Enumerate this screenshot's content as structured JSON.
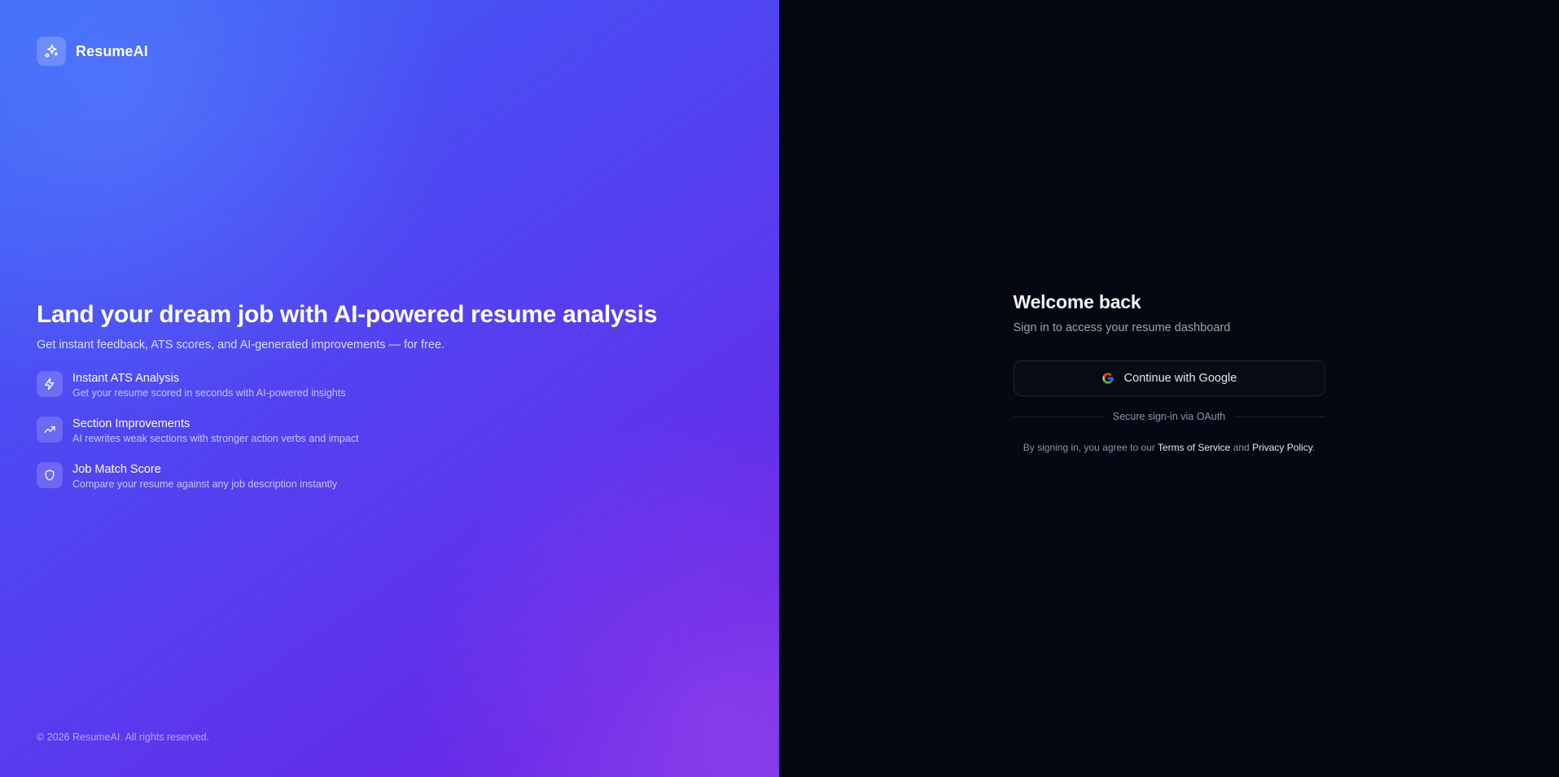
{
  "brand": {
    "name": "ResumeAI",
    "icon": "sparkles-icon"
  },
  "hero": {
    "headline": "Land your dream job with AI-powered resume analysis",
    "subtitle": "Get instant feedback, ATS scores, and AI-generated improvements — for free."
  },
  "features": [
    {
      "icon": "zap-icon",
      "title": "Instant ATS Analysis",
      "desc": "Get your resume scored in seconds with AI-powered insights"
    },
    {
      "icon": "trending-up-icon",
      "title": "Section Improvements",
      "desc": "AI rewrites weak sections with stronger action verbs and impact"
    },
    {
      "icon": "shield-icon",
      "title": "Job Match Score",
      "desc": "Compare your resume against any job description instantly"
    }
  ],
  "footer": {
    "copyright": "© 2026 ResumeAI. All rights reserved."
  },
  "signin": {
    "title": "Welcome back",
    "subtitle": "Sign in to access your resume dashboard",
    "google_button": "Continue with Google",
    "divider_text": "Secure sign-in via OAuth",
    "legal_prefix": "By signing in, you agree to our",
    "terms_link": "Terms of Service",
    "legal_and": "and",
    "privacy_link": "Privacy Policy",
    "legal_suffix": "."
  },
  "colors": {
    "gradient_start": "#3a6cf6",
    "gradient_end": "#7a35e6",
    "right_bg": "#050813"
  }
}
